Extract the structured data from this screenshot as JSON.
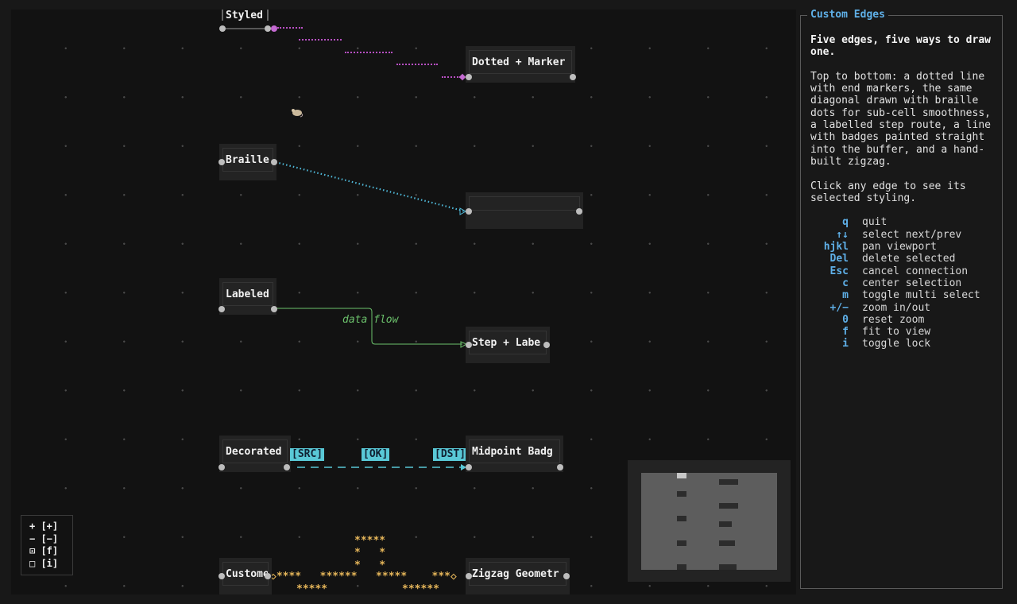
{
  "nodes": {
    "styled": "Styled",
    "dotted_marker": "Dotted + Marker",
    "braille": "Braille",
    "braille_target": "",
    "labeled": "Labeled",
    "step_label": "Step + Labe",
    "decorated": "Decorated",
    "midpoint_badge": "Midpoint Badg",
    "custom": "Custome",
    "zigzag": "Zigzag Geometr"
  },
  "edges": {
    "flow_label": "data flow",
    "badge_src": "[SRC]",
    "badge_ok": "[OK]",
    "badge_dst": "[DST]"
  },
  "zigzag_art": {
    "top": "*****",
    "mid1": "*   *",
    "mid2": "*   *",
    "row_a": "◇****   ******   *****    ***◇",
    "row_b": "*****            ******"
  },
  "zoom_controls": [
    "+ [+]",
    "− [−]",
    "⊡ [f]",
    "□ [i]"
  ],
  "sidebar": {
    "title": "Custom Edges",
    "heading": "Five edges, five ways to draw one.",
    "paragraph1": "Top to bottom: a dotted line with end markers, the same diagonal drawn with braille dots for sub-cell smoothness, a labelled step route, a line with badges painted straight into the buffer, and a hand-built zigzag.",
    "paragraph2": "Click any edge to see its selected styling.",
    "keys": [
      {
        "key": "q",
        "desc": "quit"
      },
      {
        "key": "↑↓",
        "desc": "select next/prev"
      },
      {
        "key": "hjkl",
        "desc": "pan viewport"
      },
      {
        "key": "Del",
        "desc": "delete selected"
      },
      {
        "key": "Esc",
        "desc": "cancel connection"
      },
      {
        "key": "c",
        "desc": "center selection"
      },
      {
        "key": "m",
        "desc": "toggle multi select"
      },
      {
        "key": "+/−",
        "desc": "zoom in/out"
      },
      {
        "key": "0",
        "desc": "reset zoom"
      },
      {
        "key": "f",
        "desc": "fit to view"
      },
      {
        "key": "i",
        "desc": "toggle lock"
      }
    ]
  },
  "colors": {
    "accent": "#5fb0e8",
    "dotted_edge": "#b74fc2",
    "braille_edge": "#4fb8d8",
    "step_edge": "#6cc26c",
    "badge": "#59c8d6",
    "zigzag": "#e7b75a"
  }
}
